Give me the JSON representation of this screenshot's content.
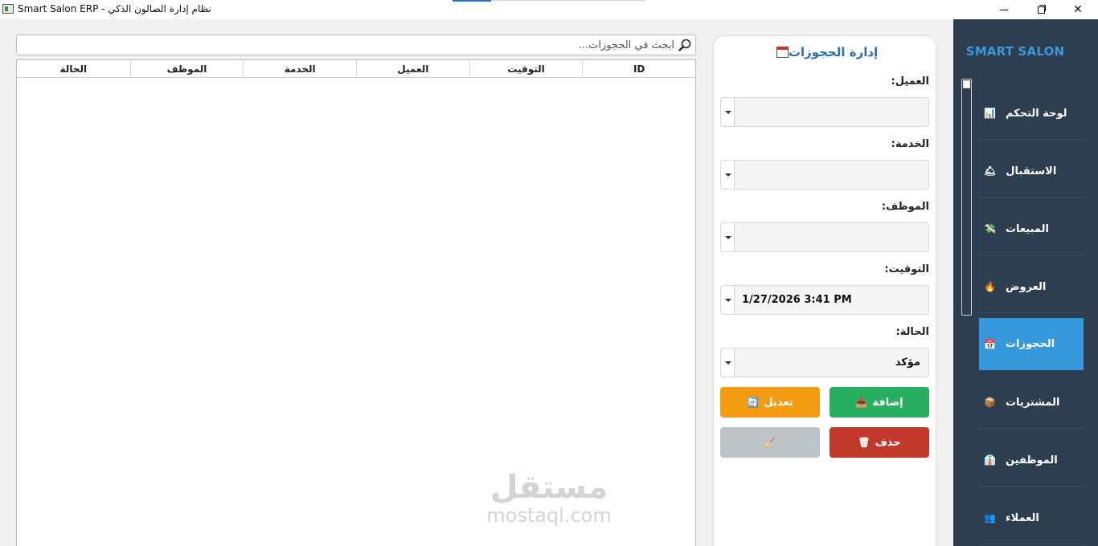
{
  "window": {
    "title": "Smart Salon ERP - نظام إدارة الصالون الذكي"
  },
  "sidebar": {
    "brand": "SMART SALON",
    "items": [
      {
        "label": "لوحة التحكم",
        "icon": "📊"
      },
      {
        "label": "الاستقبال",
        "icon": "🛎"
      },
      {
        "label": "المبيعات",
        "icon": "💸"
      },
      {
        "label": "العروض",
        "icon": "🔥"
      },
      {
        "label": "الحجوزات",
        "icon": "📅"
      },
      {
        "label": "المشتريات",
        "icon": "📦"
      },
      {
        "label": "الموظفين",
        "icon": "👔"
      },
      {
        "label": "العملاء",
        "icon": "👥"
      }
    ],
    "active_index": 4,
    "active_color": "#3498db",
    "bg_color": "#2c3e50"
  },
  "form": {
    "title": "إدارة الحجوزات",
    "fields": {
      "client_label": "العميل:",
      "client_value": "",
      "service_label": "الخدمة:",
      "service_value": "",
      "employee_label": "الموظف:",
      "employee_value": "",
      "time_label": "التوقيت:",
      "time_value": "1/27/2026 3:41 PM",
      "status_label": "الحالة:",
      "status_value": "مؤكد"
    },
    "buttons": {
      "add": "إضافة",
      "edit": "تعديل",
      "delete": "حذف",
      "clear": ""
    }
  },
  "search": {
    "placeholder": "ابحث في الحجوزات..."
  },
  "table": {
    "columns": [
      "ID",
      "التوقيت",
      "العميل",
      "الخدمة",
      "الموظف",
      "الحالة"
    ],
    "rows": []
  },
  "watermark": {
    "arabic": "مستقل",
    "latin": "mostaql.com"
  }
}
